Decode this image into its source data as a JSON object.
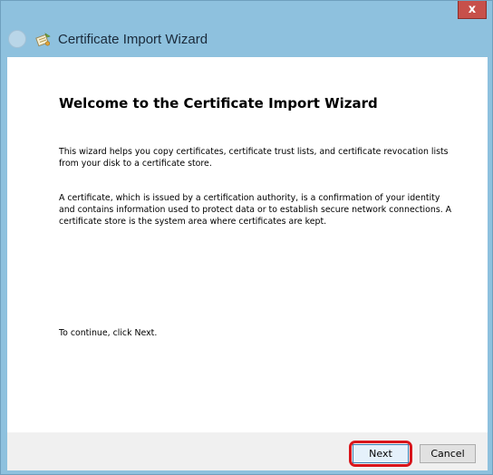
{
  "window": {
    "close_label": "x",
    "title": "Certificate Import Wizard"
  },
  "icons": {
    "back": "back-arrow-icon",
    "wizard": "certificate-wizard-icon",
    "close": "close-icon"
  },
  "page": {
    "heading": "Welcome to the Certificate Import Wizard",
    "paragraph1": "This wizard helps you copy certificates, certificate trust lists, and certificate revocation lists from your disk to a certificate store.",
    "paragraph2": "A certificate, which is issued by a certification authority, is a confirmation of your identity and contains information used to protect data or to establish secure network connections. A certificate store is the system area where certificates are kept.",
    "continue_text": "To continue, click Next."
  },
  "buttons": {
    "next": "Next",
    "cancel": "Cancel"
  },
  "colors": {
    "frame": "#8ec1de",
    "close_button": "#c7504a",
    "highlight": "#d9151b"
  }
}
